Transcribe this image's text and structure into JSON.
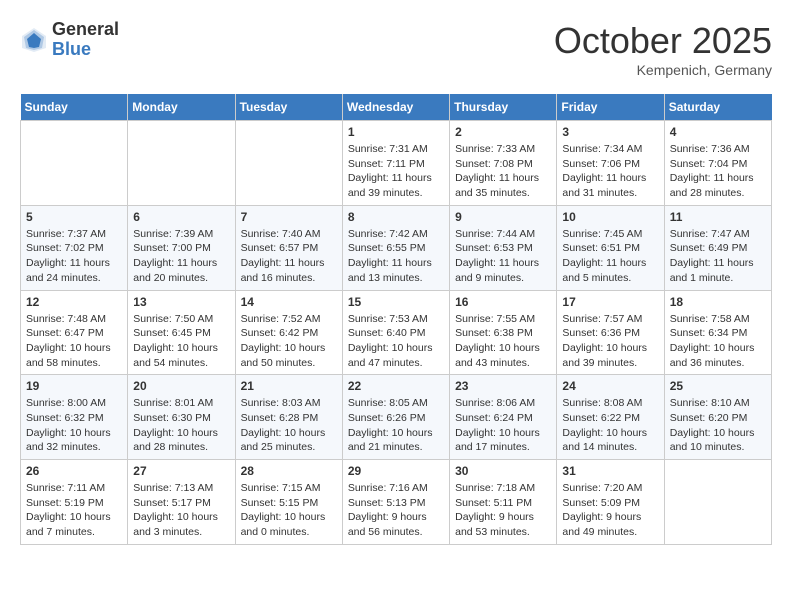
{
  "header": {
    "logo_general": "General",
    "logo_blue": "Blue",
    "month": "October 2025",
    "location": "Kempenich, Germany"
  },
  "weekdays": [
    "Sunday",
    "Monday",
    "Tuesday",
    "Wednesday",
    "Thursday",
    "Friday",
    "Saturday"
  ],
  "weeks": [
    [
      {
        "day": "",
        "sunrise": "",
        "sunset": "",
        "daylight": ""
      },
      {
        "day": "",
        "sunrise": "",
        "sunset": "",
        "daylight": ""
      },
      {
        "day": "",
        "sunrise": "",
        "sunset": "",
        "daylight": ""
      },
      {
        "day": "1",
        "sunrise": "Sunrise: 7:31 AM",
        "sunset": "Sunset: 7:11 PM",
        "daylight": "Daylight: 11 hours and 39 minutes."
      },
      {
        "day": "2",
        "sunrise": "Sunrise: 7:33 AM",
        "sunset": "Sunset: 7:08 PM",
        "daylight": "Daylight: 11 hours and 35 minutes."
      },
      {
        "day": "3",
        "sunrise": "Sunrise: 7:34 AM",
        "sunset": "Sunset: 7:06 PM",
        "daylight": "Daylight: 11 hours and 31 minutes."
      },
      {
        "day": "4",
        "sunrise": "Sunrise: 7:36 AM",
        "sunset": "Sunset: 7:04 PM",
        "daylight": "Daylight: 11 hours and 28 minutes."
      }
    ],
    [
      {
        "day": "5",
        "sunrise": "Sunrise: 7:37 AM",
        "sunset": "Sunset: 7:02 PM",
        "daylight": "Daylight: 11 hours and 24 minutes."
      },
      {
        "day": "6",
        "sunrise": "Sunrise: 7:39 AM",
        "sunset": "Sunset: 7:00 PM",
        "daylight": "Daylight: 11 hours and 20 minutes."
      },
      {
        "day": "7",
        "sunrise": "Sunrise: 7:40 AM",
        "sunset": "Sunset: 6:57 PM",
        "daylight": "Daylight: 11 hours and 16 minutes."
      },
      {
        "day": "8",
        "sunrise": "Sunrise: 7:42 AM",
        "sunset": "Sunset: 6:55 PM",
        "daylight": "Daylight: 11 hours and 13 minutes."
      },
      {
        "day": "9",
        "sunrise": "Sunrise: 7:44 AM",
        "sunset": "Sunset: 6:53 PM",
        "daylight": "Daylight: 11 hours and 9 minutes."
      },
      {
        "day": "10",
        "sunrise": "Sunrise: 7:45 AM",
        "sunset": "Sunset: 6:51 PM",
        "daylight": "Daylight: 11 hours and 5 minutes."
      },
      {
        "day": "11",
        "sunrise": "Sunrise: 7:47 AM",
        "sunset": "Sunset: 6:49 PM",
        "daylight": "Daylight: 11 hours and 1 minute."
      }
    ],
    [
      {
        "day": "12",
        "sunrise": "Sunrise: 7:48 AM",
        "sunset": "Sunset: 6:47 PM",
        "daylight": "Daylight: 10 hours and 58 minutes."
      },
      {
        "day": "13",
        "sunrise": "Sunrise: 7:50 AM",
        "sunset": "Sunset: 6:45 PM",
        "daylight": "Daylight: 10 hours and 54 minutes."
      },
      {
        "day": "14",
        "sunrise": "Sunrise: 7:52 AM",
        "sunset": "Sunset: 6:42 PM",
        "daylight": "Daylight: 10 hours and 50 minutes."
      },
      {
        "day": "15",
        "sunrise": "Sunrise: 7:53 AM",
        "sunset": "Sunset: 6:40 PM",
        "daylight": "Daylight: 10 hours and 47 minutes."
      },
      {
        "day": "16",
        "sunrise": "Sunrise: 7:55 AM",
        "sunset": "Sunset: 6:38 PM",
        "daylight": "Daylight: 10 hours and 43 minutes."
      },
      {
        "day": "17",
        "sunrise": "Sunrise: 7:57 AM",
        "sunset": "Sunset: 6:36 PM",
        "daylight": "Daylight: 10 hours and 39 minutes."
      },
      {
        "day": "18",
        "sunrise": "Sunrise: 7:58 AM",
        "sunset": "Sunset: 6:34 PM",
        "daylight": "Daylight: 10 hours and 36 minutes."
      }
    ],
    [
      {
        "day": "19",
        "sunrise": "Sunrise: 8:00 AM",
        "sunset": "Sunset: 6:32 PM",
        "daylight": "Daylight: 10 hours and 32 minutes."
      },
      {
        "day": "20",
        "sunrise": "Sunrise: 8:01 AM",
        "sunset": "Sunset: 6:30 PM",
        "daylight": "Daylight: 10 hours and 28 minutes."
      },
      {
        "day": "21",
        "sunrise": "Sunrise: 8:03 AM",
        "sunset": "Sunset: 6:28 PM",
        "daylight": "Daylight: 10 hours and 25 minutes."
      },
      {
        "day": "22",
        "sunrise": "Sunrise: 8:05 AM",
        "sunset": "Sunset: 6:26 PM",
        "daylight": "Daylight: 10 hours and 21 minutes."
      },
      {
        "day": "23",
        "sunrise": "Sunrise: 8:06 AM",
        "sunset": "Sunset: 6:24 PM",
        "daylight": "Daylight: 10 hours and 17 minutes."
      },
      {
        "day": "24",
        "sunrise": "Sunrise: 8:08 AM",
        "sunset": "Sunset: 6:22 PM",
        "daylight": "Daylight: 10 hours and 14 minutes."
      },
      {
        "day": "25",
        "sunrise": "Sunrise: 8:10 AM",
        "sunset": "Sunset: 6:20 PM",
        "daylight": "Daylight: 10 hours and 10 minutes."
      }
    ],
    [
      {
        "day": "26",
        "sunrise": "Sunrise: 7:11 AM",
        "sunset": "Sunset: 5:19 PM",
        "daylight": "Daylight: 10 hours and 7 minutes."
      },
      {
        "day": "27",
        "sunrise": "Sunrise: 7:13 AM",
        "sunset": "Sunset: 5:17 PM",
        "daylight": "Daylight: 10 hours and 3 minutes."
      },
      {
        "day": "28",
        "sunrise": "Sunrise: 7:15 AM",
        "sunset": "Sunset: 5:15 PM",
        "daylight": "Daylight: 10 hours and 0 minutes."
      },
      {
        "day": "29",
        "sunrise": "Sunrise: 7:16 AM",
        "sunset": "Sunset: 5:13 PM",
        "daylight": "Daylight: 9 hours and 56 minutes."
      },
      {
        "day": "30",
        "sunrise": "Sunrise: 7:18 AM",
        "sunset": "Sunset: 5:11 PM",
        "daylight": "Daylight: 9 hours and 53 minutes."
      },
      {
        "day": "31",
        "sunrise": "Sunrise: 7:20 AM",
        "sunset": "Sunset: 5:09 PM",
        "daylight": "Daylight: 9 hours and 49 minutes."
      },
      {
        "day": "",
        "sunrise": "",
        "sunset": "",
        "daylight": ""
      }
    ]
  ]
}
